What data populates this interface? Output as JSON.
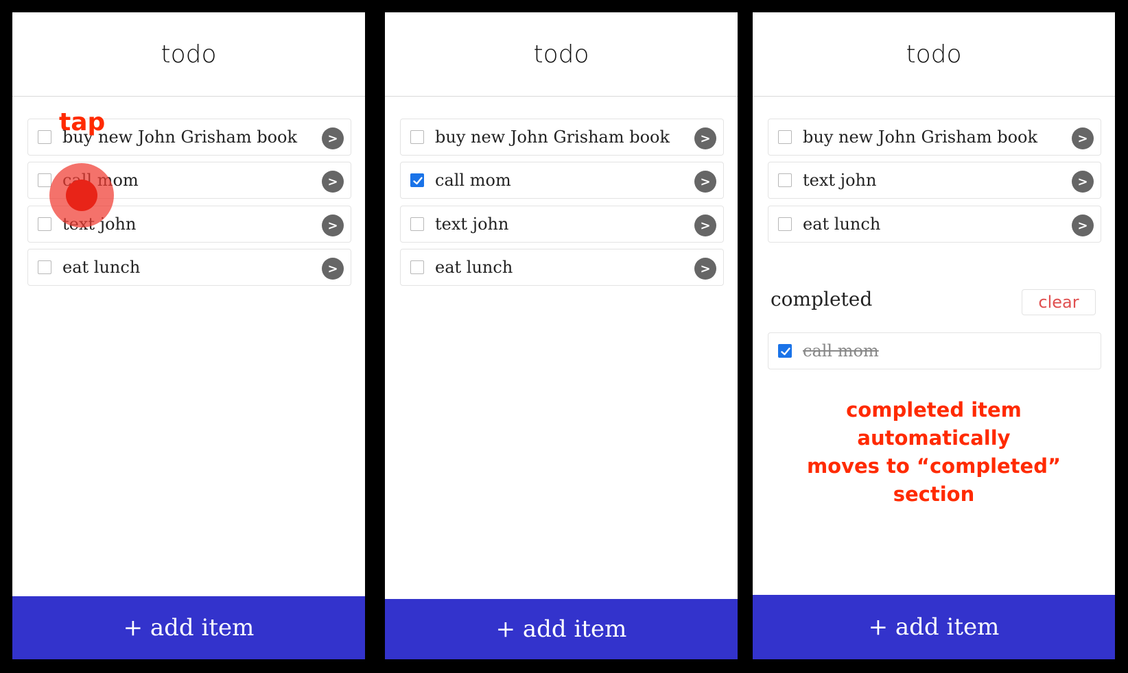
{
  "colors": {
    "accent": "#3333cc",
    "checked": "#1a73e8",
    "annotation": "#ff2a00",
    "clear_text": "#e05050"
  },
  "screen1": {
    "header": {
      "title": "todo"
    },
    "items": [
      {
        "label": "buy new John Grisham book",
        "checked": false
      },
      {
        "label": "call mom",
        "checked": false
      },
      {
        "label": "text john",
        "checked": false
      },
      {
        "label": "eat lunch",
        "checked": false
      }
    ],
    "arrow_label": ">",
    "add_label": "+ add item",
    "annotation": {
      "tap_text": "tap"
    }
  },
  "screen2": {
    "header": {
      "title": "todo"
    },
    "items": [
      {
        "label": "buy new John Grisham book",
        "checked": false
      },
      {
        "label": "call mom",
        "checked": true
      },
      {
        "label": "text john",
        "checked": false
      },
      {
        "label": "eat lunch",
        "checked": false
      }
    ],
    "arrow_label": ">",
    "add_label": "+ add item"
  },
  "screen3": {
    "header": {
      "title": "todo"
    },
    "items": [
      {
        "label": "buy new John Grisham book",
        "checked": false
      },
      {
        "label": "text john",
        "checked": false
      },
      {
        "label": "eat lunch",
        "checked": false
      }
    ],
    "completed_section": {
      "title": "completed",
      "clear_label": "clear",
      "items": [
        {
          "label": "call mom",
          "checked": true
        }
      ]
    },
    "arrow_label": ">",
    "add_label": "+ add item",
    "annotation": {
      "line1": "completed item automatically",
      "line2": "moves to “completed” section"
    }
  }
}
